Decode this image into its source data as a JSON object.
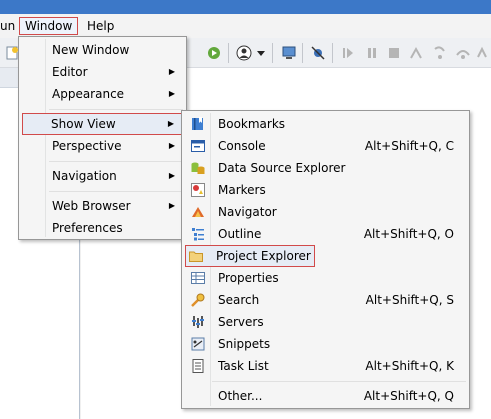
{
  "menubar": {
    "run": "un",
    "window": "Window",
    "help": "Help"
  },
  "window_menu": {
    "items": [
      {
        "label": "New Window"
      },
      {
        "label": "Editor"
      },
      {
        "label": "Appearance"
      },
      {
        "label": "Show View"
      },
      {
        "label": "Perspective"
      },
      {
        "label": "Navigation"
      },
      {
        "label": "Web Browser"
      },
      {
        "label": "Preferences"
      }
    ],
    "arrow": "▶"
  },
  "show_view_menu": {
    "items": [
      {
        "label": "Bookmarks",
        "accel": "",
        "icon": "bookmarks-icon"
      },
      {
        "label": "Console",
        "accel": "Alt+Shift+Q, C",
        "icon": "console-icon"
      },
      {
        "label": "Data Source Explorer",
        "accel": "",
        "icon": "data-source-icon"
      },
      {
        "label": "Markers",
        "accel": "",
        "icon": "markers-icon"
      },
      {
        "label": "Navigator",
        "accel": "",
        "icon": "navigator-icon"
      },
      {
        "label": "Outline",
        "accel": "Alt+Shift+Q, O",
        "icon": "outline-icon"
      },
      {
        "label": "Project Explorer",
        "accel": "",
        "icon": "folder-icon"
      },
      {
        "label": "Properties",
        "accel": "",
        "icon": "properties-icon"
      },
      {
        "label": "Search",
        "accel": "Alt+Shift+Q, S",
        "icon": "search-icon"
      },
      {
        "label": "Servers",
        "accel": "",
        "icon": "servers-icon"
      },
      {
        "label": "Snippets",
        "accel": "",
        "icon": "snippets-icon"
      },
      {
        "label": "Task List",
        "accel": "Alt+Shift+Q, K",
        "icon": "task-list-icon"
      },
      {
        "label": "Other...",
        "accel": "Alt+Shift+Q, Q",
        "icon": ""
      }
    ]
  }
}
